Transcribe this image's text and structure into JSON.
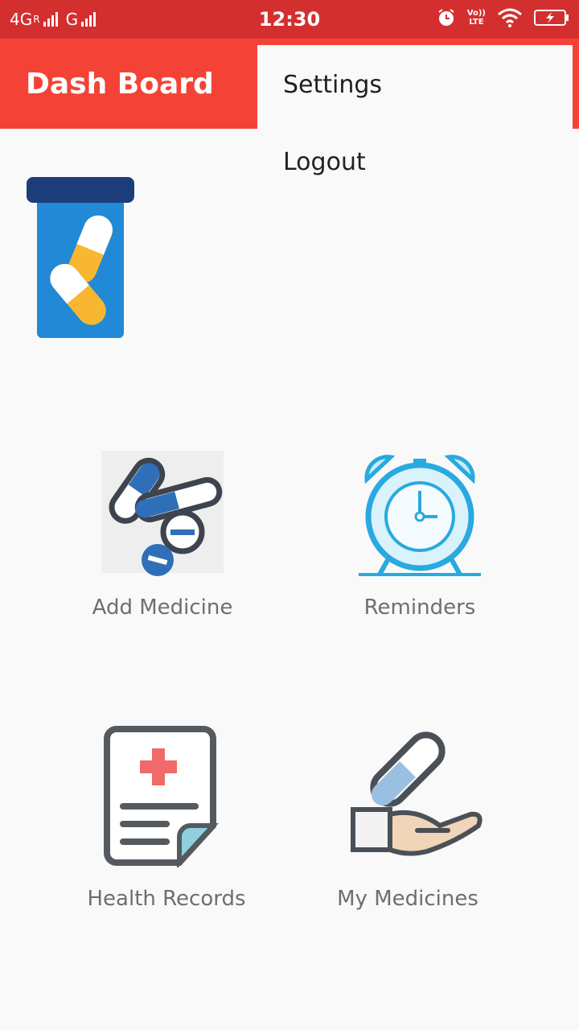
{
  "status_bar": {
    "network_left": "4G",
    "network_left_sup": "R",
    "network_right": "G",
    "time": "12:30",
    "volte_top": "Vo))",
    "volte_bottom": "LTE",
    "icons": [
      "signal-icon",
      "alarm-icon",
      "wifi-icon",
      "battery-charging-icon"
    ]
  },
  "toolbar": {
    "title": "Dash Board"
  },
  "overflow_menu": {
    "items": [
      {
        "label": "Settings"
      },
      {
        "label": "Logout"
      }
    ]
  },
  "tiles": [
    {
      "label": "Add Medicine",
      "icon": "pills-icon"
    },
    {
      "label": "Reminders",
      "icon": "alarm-clock-icon"
    },
    {
      "label": "Health Records",
      "icon": "health-record-icon"
    },
    {
      "label": "My Medicines",
      "icon": "hand-capsule-icon"
    }
  ],
  "colors": {
    "status_bar": "#d32f2f",
    "toolbar": "#f44336",
    "background": "#f9f9f9"
  }
}
